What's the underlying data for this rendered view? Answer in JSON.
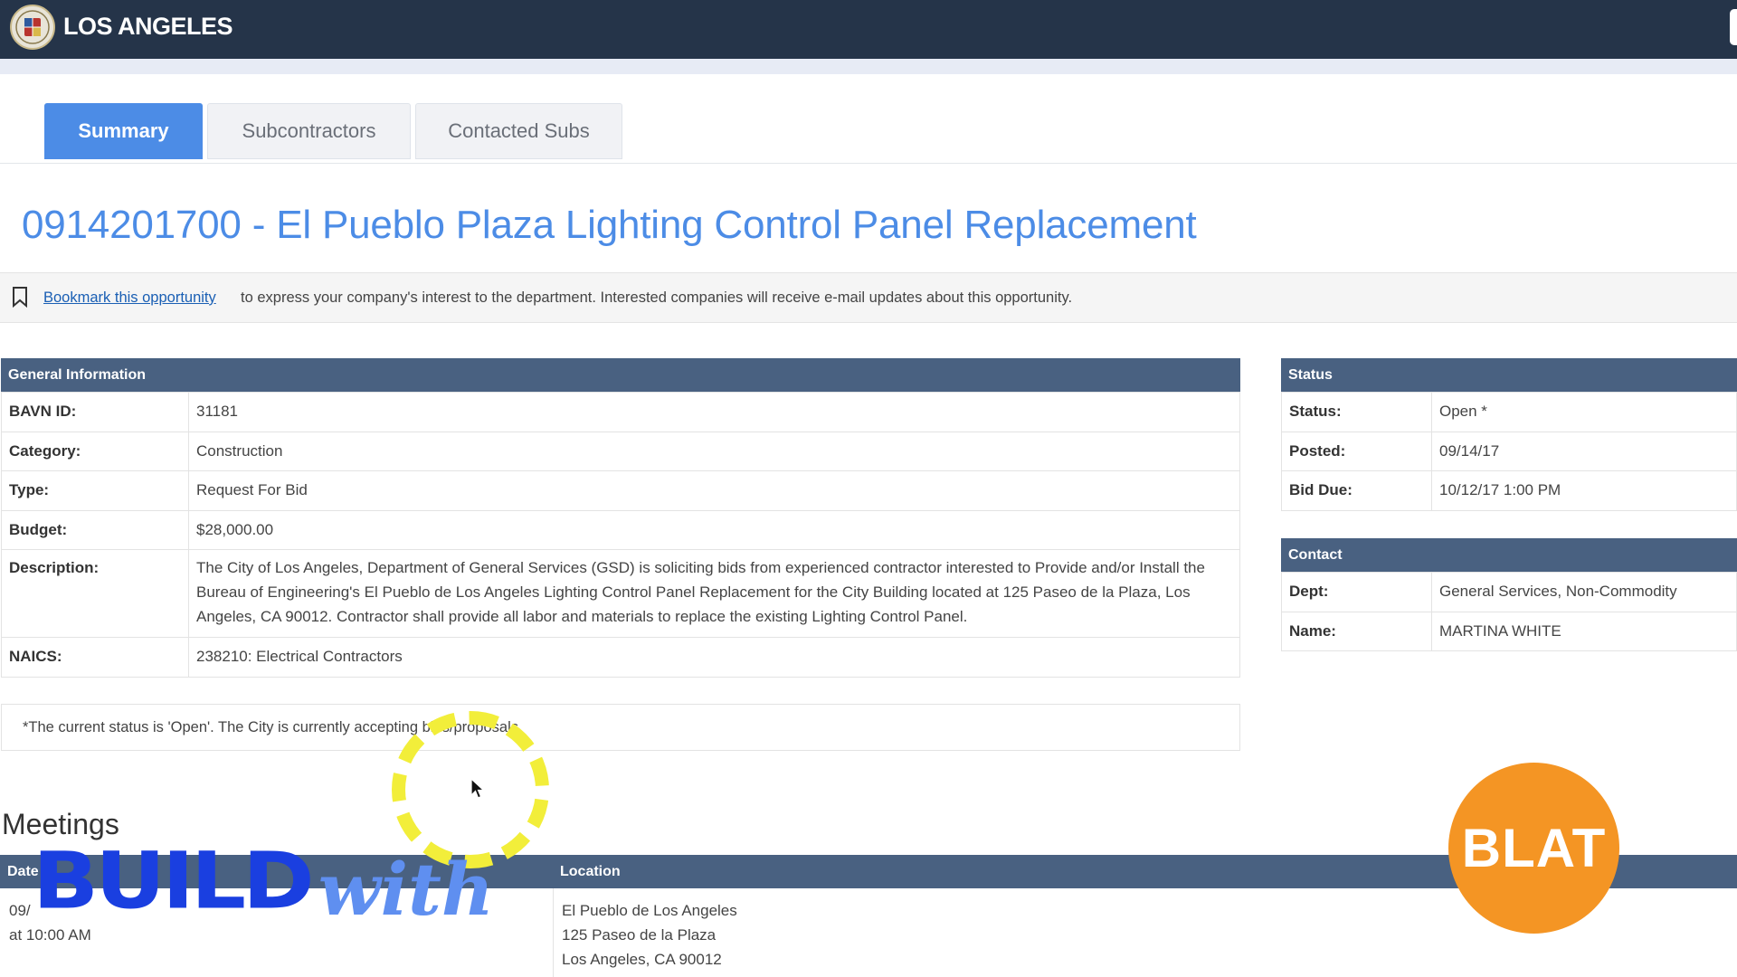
{
  "header": {
    "city_name": "LOS ANGELES"
  },
  "tabs": [
    {
      "label": "Summary",
      "active": true
    },
    {
      "label": "Subcontractors",
      "active": false
    },
    {
      "label": "Contacted Subs",
      "active": false
    }
  ],
  "page_title": "0914201700 - El Pueblo Plaza Lighting Control Panel Replacement",
  "bookmark": {
    "link_text": "Bookmark this opportunity",
    "text": "to express your company's interest to the department. Interested companies will receive e-mail updates about this opportunity."
  },
  "general_info": {
    "heading": "General Information",
    "rows": [
      {
        "label": "BAVN ID:",
        "value": "31181"
      },
      {
        "label": "Category:",
        "value": "Construction"
      },
      {
        "label": "Type:",
        "value": "Request For Bid"
      },
      {
        "label": "Budget:",
        "value": "$28,000.00"
      },
      {
        "label": "Description:",
        "value": "The City of Los Angeles, Department of General Services (GSD) is soliciting bids from experienced contractor interested to Provide and/or Install the Bureau of Engineering's El Pueblo de Los Angeles Lighting Control Panel Replacement for the City Building located at 125 Paseo de la Plaza, Los Angeles, CA 90012. Contractor shall provide all labor and materials to replace the existing Lighting Control Panel."
      },
      {
        "label": "NAICS:",
        "value": "238210: Electrical Contractors"
      }
    ]
  },
  "status_panel": {
    "heading": "Status",
    "rows": [
      {
        "label": "Status:",
        "value": "Open *"
      },
      {
        "label": "Posted:",
        "value": "09/14/17"
      },
      {
        "label": "Bid Due:",
        "value": "10/12/17 1:00 PM"
      }
    ]
  },
  "contact_panel": {
    "heading": "Contact",
    "rows": [
      {
        "label": "Dept:",
        "value": "General Services, Non-Commodity"
      },
      {
        "label": "Name:",
        "value": "MARTINA WHITE"
      }
    ]
  },
  "status_note": "*The current status is 'Open'. The City is currently accepting bids/proposals.",
  "meetings": {
    "title": "Meetings",
    "columns": {
      "date": "Date",
      "location": "Location"
    },
    "row": {
      "date_line1": "09/",
      "date_line2": "at 10:00 AM",
      "location_line1": "El Pueblo de Los Angeles",
      "location_line2": "125 Paseo de la Plaza",
      "location_line3": "Los Angeles, CA 90012"
    }
  },
  "overlay": {
    "build_word1": "BUILD",
    "build_word2": "with",
    "badge": "BLAT"
  },
  "colors": {
    "header_bg": "#253449",
    "accent_blue": "#4c8ce6",
    "panel_head": "#496181",
    "badge_orange": "#f49524",
    "cursor_ring": "#f2ee3a"
  }
}
